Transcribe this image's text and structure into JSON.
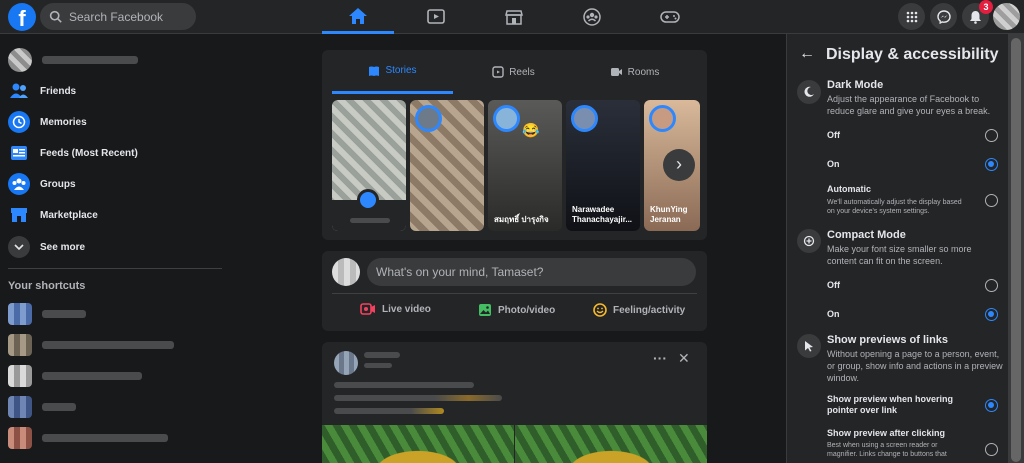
{
  "topbar": {
    "logo": "f",
    "search_placeholder": "Search Facebook",
    "nav_icons": [
      "home-icon",
      "watch-icon",
      "marketplace-icon",
      "groups-icon",
      "gaming-icon"
    ],
    "notif_count": "3",
    "accent": "#2d88ff"
  },
  "leftnav": {
    "items": [
      {
        "label": "Friends",
        "icon": "friends-icon"
      },
      {
        "label": "Memories",
        "icon": "memories-icon"
      },
      {
        "label": "Feeds (Most Recent)",
        "icon": "feeds-icon"
      },
      {
        "label": "Groups",
        "icon": "groups-icon"
      },
      {
        "label": "Marketplace",
        "icon": "marketplace-icon"
      },
      {
        "label": "See more",
        "icon": "chevron-down-icon"
      }
    ],
    "shortcuts_title": "Your shortcuts"
  },
  "stories": {
    "tabs": [
      "Stories",
      "Reels",
      "Rooms"
    ],
    "cards": [
      {
        "name": ""
      },
      {
        "name": ""
      },
      {
        "name": "สมฤทธิ์ ปารุงกิจ"
      },
      {
        "name": "Narawadee Thanachayajir..."
      },
      {
        "name": "KhunYing Jeranan"
      }
    ]
  },
  "composer": {
    "placeholder": "What's on your mind, Tamaset?",
    "actions": [
      "Live video",
      "Photo/video",
      "Feeling/activity"
    ]
  },
  "panel": {
    "title": "Display & accessibility",
    "dark_mode": {
      "title": "Dark Mode",
      "desc": "Adjust the appearance of Facebook to reduce glare and give your eyes a break.",
      "off": "Off",
      "on": "On",
      "automatic": "Automatic",
      "automatic_desc": "We'll automatically adjust the display based on your device's system settings.",
      "selected": "On"
    },
    "compact_mode": {
      "title": "Compact Mode",
      "desc": "Make your font size smaller so more content can fit on the screen.",
      "off": "Off",
      "on": "On",
      "selected": "On"
    },
    "link_previews": {
      "title": "Show previews of links",
      "desc": "Without opening a page to a person, event, or group, show info and actions in a preview window.",
      "hover": "Show preview when hovering pointer over link",
      "click": "Show preview after clicking",
      "click_desc": "Best when using a screen reader or magnifier. Links change to buttons that",
      "selected": "hover"
    }
  }
}
